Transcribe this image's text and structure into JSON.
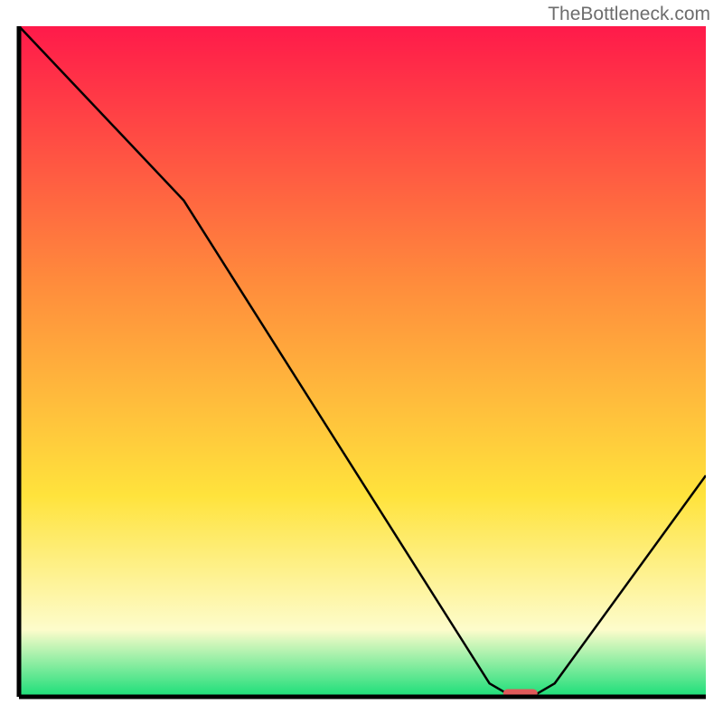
{
  "watermark": "TheBottleneck.com",
  "chart_data": {
    "type": "line",
    "title": "",
    "xlabel": "",
    "ylabel": "",
    "xlim": [
      0,
      100
    ],
    "ylim": [
      0,
      100
    ],
    "curve_points": [
      {
        "x": 0,
        "y": 100
      },
      {
        "x": 24,
        "y": 74
      },
      {
        "x": 68.5,
        "y": 2
      },
      {
        "x": 71,
        "y": 0.5
      },
      {
        "x": 75.5,
        "y": 0.5
      },
      {
        "x": 78,
        "y": 2
      },
      {
        "x": 100,
        "y": 33
      }
    ],
    "marker": {
      "x": 73,
      "y": 0.5,
      "width": 5,
      "height": 1.3,
      "color": "#e05a5a"
    },
    "background_gradient": {
      "red": "#ff1a4a",
      "orange": "#ff8b3c",
      "yellow": "#ffe33c",
      "pale": "#fdfccb",
      "green": "#1ade78"
    },
    "axis_color": "#000000"
  }
}
